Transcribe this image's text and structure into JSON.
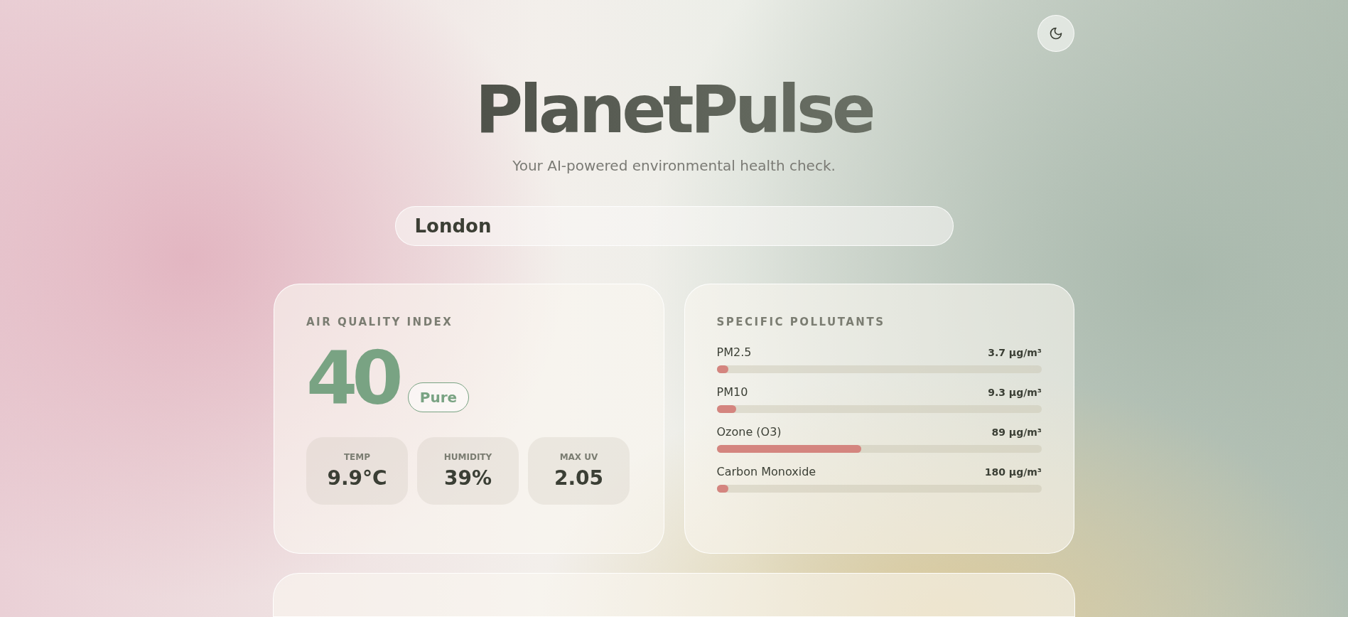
{
  "header": {
    "title": "PlanetPulse",
    "subtitle": "Your AI-powered environmental health check."
  },
  "search": {
    "value": "London"
  },
  "aqi_card": {
    "heading": "AIR QUALITY INDEX",
    "value": "40",
    "badge": "Pure",
    "stats": [
      {
        "label": "TEMP",
        "value": "9.9°C"
      },
      {
        "label": "HUMIDITY",
        "value": "39%"
      },
      {
        "label": "MAX UV",
        "value": "2.05"
      }
    ]
  },
  "pollutants_card": {
    "heading": "SPECIFIC POLLUTANTS",
    "items": [
      {
        "name": "PM2.5",
        "reading": "3.7 µg/m³",
        "level": 0.037
      },
      {
        "name": "PM10",
        "reading": "9.3 µg/m³",
        "level": 0.061
      },
      {
        "name": "Ozone (O3)",
        "reading": "89 µg/m³",
        "level": 0.445
      },
      {
        "name": "Carbon Monoxide",
        "reading": "180 µg/m³",
        "level": 0.035
      }
    ]
  }
}
